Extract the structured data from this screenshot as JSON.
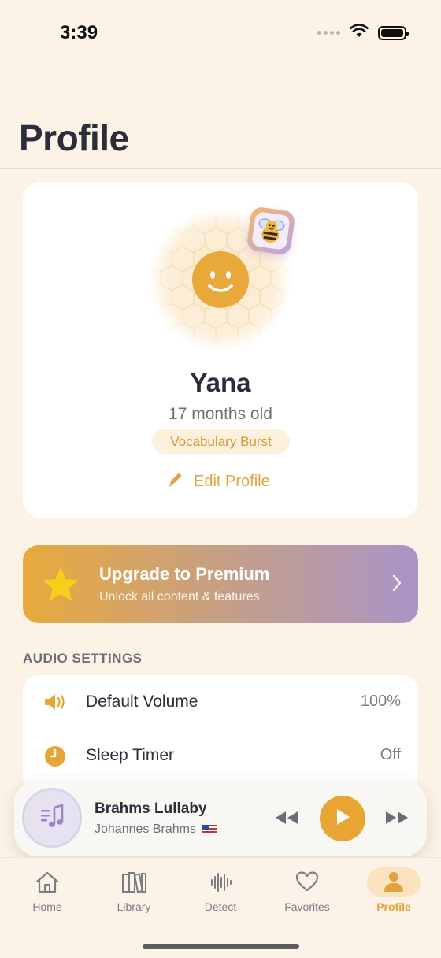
{
  "status_bar": {
    "time": "3:39"
  },
  "page": {
    "title": "Profile"
  },
  "profile": {
    "name": "Yana",
    "age": "17 months old",
    "stage": "Vocabulary Burst",
    "edit_label": "Edit Profile"
  },
  "premium": {
    "title": "Upgrade to Premium",
    "subtitle": "Unlock all content & features"
  },
  "audio_settings": {
    "section_label": "AUDIO SETTINGS",
    "items": [
      {
        "icon": "speaker-icon",
        "label": "Default Volume",
        "value": "100%"
      },
      {
        "icon": "clock-icon",
        "label": "Sleep Timer",
        "value": "Off"
      }
    ]
  },
  "player": {
    "title": "Brahms Lullaby",
    "artist": "Johannes Brahms"
  },
  "tabs": [
    {
      "label": "Home",
      "icon": "home-icon",
      "active": false
    },
    {
      "label": "Library",
      "icon": "library-icon",
      "active": false
    },
    {
      "label": "Detect",
      "icon": "waveform-icon",
      "active": false
    },
    {
      "label": "Favorites",
      "icon": "heart-icon",
      "active": false
    },
    {
      "label": "Profile",
      "icon": "person-icon",
      "active": true
    }
  ],
  "colors": {
    "background": "#fcf3e6",
    "accent": "#e8a534",
    "premium_start": "#e8aa3c",
    "premium_end": "#a995c8"
  }
}
